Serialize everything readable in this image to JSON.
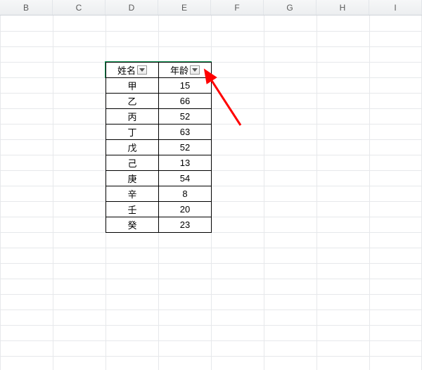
{
  "columns": [
    "B",
    "C",
    "D",
    "E",
    "F",
    "G",
    "H",
    "I"
  ],
  "table": {
    "headers": {
      "name": "姓名",
      "age": "年龄"
    },
    "rows": [
      {
        "name": "甲",
        "age": "15"
      },
      {
        "name": "乙",
        "age": "66"
      },
      {
        "name": "丙",
        "age": "52"
      },
      {
        "name": "丁",
        "age": "63"
      },
      {
        "name": "戊",
        "age": "52"
      },
      {
        "name": "己",
        "age": "13"
      },
      {
        "name": "庚",
        "age": "54"
      },
      {
        "name": "辛",
        "age": "8"
      },
      {
        "name": "壬",
        "age": "20"
      },
      {
        "name": "癸",
        "age": "23"
      }
    ]
  },
  "annotation_color": "#ff0000"
}
